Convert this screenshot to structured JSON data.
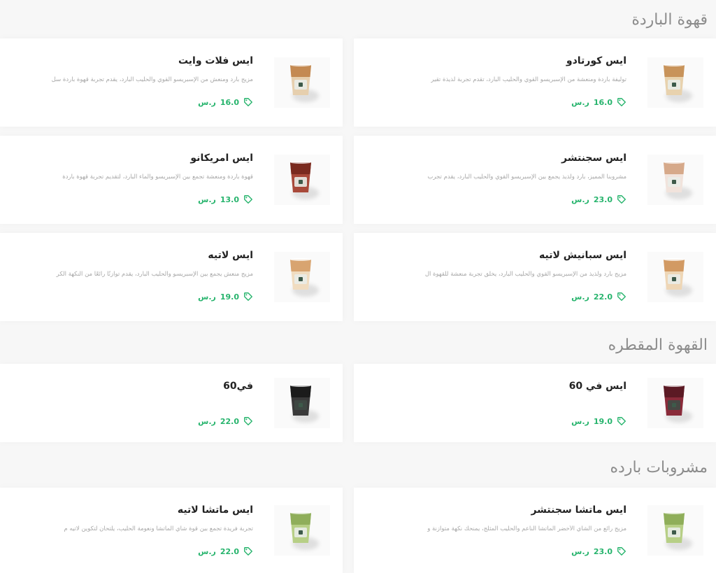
{
  "sections": [
    {
      "title": "قهوة الباردة",
      "items": [
        {
          "name": "ايس كورتادو",
          "desc": "توليفة باردة ومنعشة من الإسبريسو القوي والحليب البارد، تقدم تجربة لذيذة تقير",
          "price": "16.0",
          "currency": "ر.س",
          "cup": "cortado"
        },
        {
          "name": "ايس فلات وايت",
          "desc": "مزيج بارد ومنعش من الإسبريسو القوي والحليب البارد، يقدم تجربة قهوة باردة سل",
          "price": "16.0",
          "currency": "ر.س",
          "cup": "flatwhite"
        },
        {
          "name": "ايس سجنتشر",
          "desc": "مشروبنا المميز، بارد ولذيذ يجمع بين الإسبريسو القوي والحليب البارد، يقدم تجرب",
          "price": "23.0",
          "currency": "ر.س",
          "cup": "signature"
        },
        {
          "name": "ايس امريكانو",
          "desc": "قهوة باردة ومنعشة تجمع بين الإسبريسو والماء البارد، لتقديم تجربة قهوة باردة",
          "price": "13.0",
          "currency": "ر.س",
          "cup": "americano"
        },
        {
          "name": "ايس سبانيش لاتيه",
          "desc": "مزيج بارد ولذيذ من الإسبريسو القوي والحليب البارد، يخلق تجربة منعشة للقهوة ال",
          "price": "22.0",
          "currency": "ر.س",
          "cup": "spanish"
        },
        {
          "name": "ايس لاتيه",
          "desc": "مزيج منعش يجمع بين الإسبريسو والحليب البارد، يقدم توازنًا رائعًا من النكهة الكر",
          "price": "19.0",
          "currency": "ر.س",
          "cup": "latte"
        }
      ]
    },
    {
      "title": "القهوة المقطره",
      "items": [
        {
          "name": "ايس في 60",
          "desc": "",
          "price": "19.0",
          "currency": "ر.س",
          "cup": "v60iced"
        },
        {
          "name": "في60",
          "desc": "",
          "price": "22.0",
          "currency": "ر.س",
          "cup": "v60hot"
        }
      ]
    },
    {
      "title": "مشروبات بارده",
      "items": [
        {
          "name": "ايس ماتشا سجنتشر",
          "desc": "مزيج رائع من الشاي الأخضر الماتشا الناعم والحليب المثلج، يمنحك نكهة متوازنة و",
          "price": "23.0",
          "currency": "ر.س",
          "cup": "matcha"
        },
        {
          "name": "ايس ماتشا لاتيه",
          "desc": "تجربة فريدة تجمع بين قوة شاي الماتشا ونعومة الحليب، يلتحان لتكوين لاتيه م",
          "price": "22.0",
          "currency": "ر.س",
          "cup": "matcha"
        }
      ]
    }
  ],
  "colors": {
    "price": "#27b46d",
    "title": "#8c8c8c"
  },
  "icons": {
    "price_tag": "tag-icon",
    "product": "iced-cup-icon"
  }
}
